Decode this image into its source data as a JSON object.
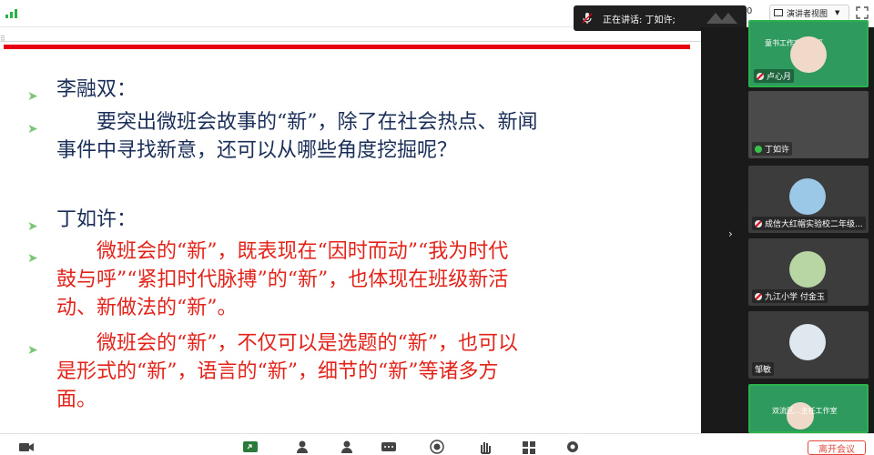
{
  "top_bar": {
    "speaker_label": "正在讲话: 丁如许;",
    "zoom_value": "0",
    "view_button_label": "演讲者视图"
  },
  "slide": {
    "paragraphs": [
      {
        "speaker": "李融双:",
        "color": "#1a2e57"
      },
      {
        "text": "要突出微班会故事的“新”，除了在社会热点、新闻事件中寻找新意，还可以从哪些角度挖掘呢？",
        "color": "#1a2e57"
      },
      {
        "speaker": "丁如许:",
        "color": "#1a2e57"
      },
      {
        "text": "微班会的“新”，既表现在“因时而动”“我为时代鼓与呼”“紧扣时代脉搏”的“新”，也体现在班级新活动、新做法的“新”。",
        "color": "#e2231a"
      },
      {
        "text": "微班会的“新”，不仅可以是选题的“新”，也可以是形式的“新”，语言的“新”，细节的“新”等诸多方面。",
        "color": "#e2231a"
      }
    ],
    "lines": {
      "p1_l1": "李融双：",
      "p2_l1": "要突出微班会故事的“新”，除了在社会热点、新闻",
      "p2_l2": "事件中寻找新意，还可以从哪些角度挖掘呢？",
      "p3_l1": "丁如许：",
      "p4_l1": "微班会的“新”，既表现在“因时而动”“我为时代",
      "p4_l2": "鼓与呼”“紧扣时代脉搏”的“新”，也体现在班级新活",
      "p4_l3": "动、新做法的“新”。",
      "p5_l1": "微班会的“新”，不仅可以是选题的“新”，也可以",
      "p5_l2": "是形式的“新”，语言的“新”，细节的“新”等诸多方",
      "p5_l3": "面。"
    }
  },
  "participants": [
    {
      "name": "卢心月",
      "mic": "muted",
      "banner": "童书工作室暑期班"
    },
    {
      "name": "丁如许",
      "mic": "active"
    },
    {
      "name": "成信大红帽实验校二年级...",
      "mic": "muted"
    },
    {
      "name": "九江小学 付金玉",
      "mic": "muted"
    },
    {
      "name": "邹敏",
      "mic": "none"
    },
    {
      "name": "双流区...主任工作室",
      "mic": "none"
    }
  ],
  "bottom_bar": {
    "end_button_label": "离开会议"
  },
  "colors": {
    "accent_red": "#e60012",
    "slide_blue": "#1a2e57",
    "slide_red": "#e2231a",
    "bullet_green": "#7cc576",
    "active_green": "#2bb24a"
  }
}
